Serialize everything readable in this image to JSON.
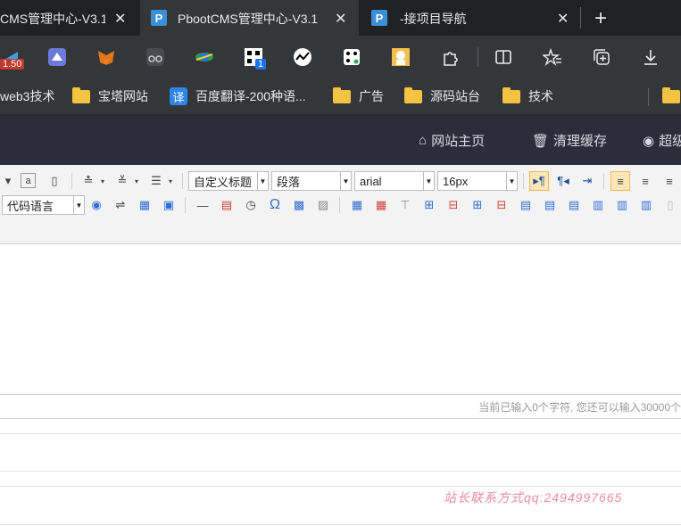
{
  "browser": {
    "tabs": [
      {
        "title": "CMS管理中心-V3.1",
        "close": "✕"
      },
      {
        "title": "PbootCMS管理中心-V3.1",
        "close": "✕",
        "favicon": "P"
      },
      {
        "title": "-接项目导航",
        "close": "✕",
        "favicon": "P"
      }
    ],
    "new_tab": "+",
    "extensions_badge_1": "1.50",
    "extensions_badge_2": "1"
  },
  "bookmarks": [
    {
      "label": "web3技术"
    },
    {
      "label": "宝塔网站"
    },
    {
      "label": "百度翻译-200种语..."
    },
    {
      "label": "广告"
    },
    {
      "label": "源码站台"
    },
    {
      "label": "技术"
    }
  ],
  "bookmark_translate_icon": "译",
  "cms_header": {
    "home": "网站主页",
    "clear_cache": "清理缓存",
    "user": "超级"
  },
  "editor": {
    "heading_select": "自定义标题",
    "paragraph_select": "段落",
    "font_select": "arial",
    "size_select": "16px",
    "code_lang_select": "代码语言"
  },
  "status_text": "当前已输入0个字符, 您还可以输入30000个",
  "watermark": "站长联系方式qq:2494997665",
  "colors": {
    "tabbar": "#202124",
    "toolbar": "#35363a",
    "cms_header": "#2b2d3a",
    "accent_tab_icon": "#3b8fd6",
    "folder": "#f5c342"
  }
}
